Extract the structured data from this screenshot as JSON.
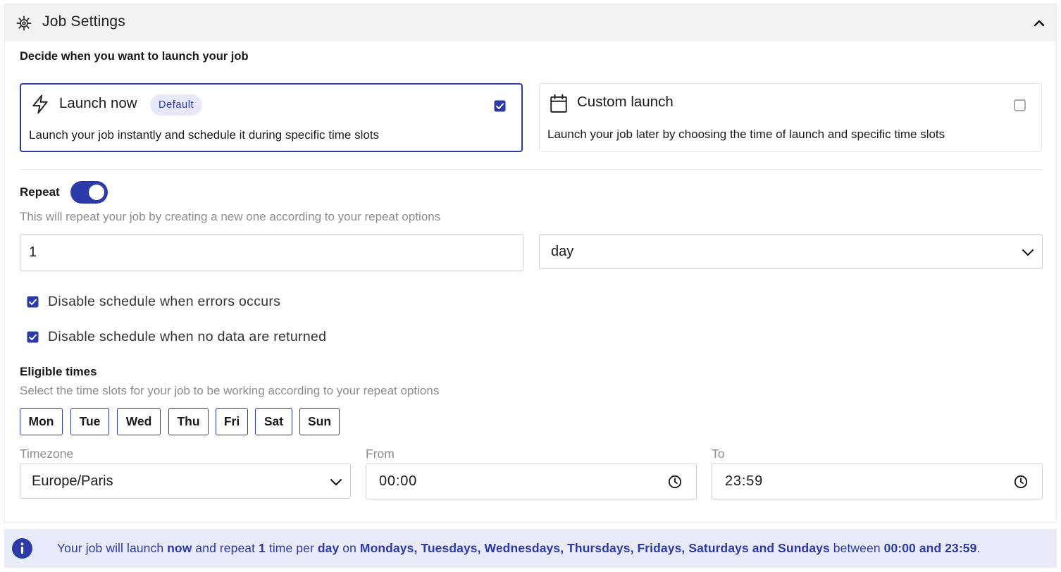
{
  "header": {
    "title": "Job Settings",
    "icon": "gear-icon",
    "collapse_icon": "chevron-up-icon"
  },
  "launch": {
    "section_label": "Decide when you want to launch your job",
    "options": [
      {
        "title": "Launch now",
        "badge": "Default",
        "description": "Launch your job instantly and schedule it during specific time slots",
        "icon": "lightning-icon",
        "checked": true
      },
      {
        "title": "Custom launch",
        "description": "Launch your job later by choosing the time of launch and specific time slots",
        "icon": "calendar-icon",
        "checked": false
      }
    ]
  },
  "repeat": {
    "label": "Repeat",
    "enabled": true,
    "help": "This will repeat your job by creating a new one according to your repeat options",
    "count": "1",
    "unit": "day"
  },
  "options": {
    "disable_on_errors": {
      "label": "Disable schedule when errors occurs",
      "checked": true
    },
    "disable_on_no_data": {
      "label": "Disable schedule when no data are returned",
      "checked": true
    }
  },
  "eligible": {
    "label": "Eligible times",
    "help": "Select the time slots for your job to be working according to your repeat options",
    "days": [
      "Mon",
      "Tue",
      "Wed",
      "Thu",
      "Fri",
      "Sat",
      "Sun"
    ]
  },
  "schedule": {
    "timezone_label": "Timezone",
    "timezone": "Europe/Paris",
    "from_label": "From",
    "from": "00:00",
    "to_label": "To",
    "to": "23:59"
  },
  "summary": {
    "icon": "info-icon",
    "t1": "Your job will launch ",
    "launch_mode": "now",
    "t2": " and repeat ",
    "count": "1",
    "t3": " time per ",
    "unit": "day",
    "t4": " on ",
    "days": "Mondays, Tuesdays, Wednesdays, Thursdays, Fridays, Saturdays and Sundays",
    "t5": " between ",
    "range": "00:00 and 23:59",
    "t6": "."
  },
  "colors": {
    "accent": "#2b3aa8",
    "header_bg": "#f2f2f2",
    "banner_bg": "#e8eaf8",
    "muted_text": "#8c8c8c"
  }
}
